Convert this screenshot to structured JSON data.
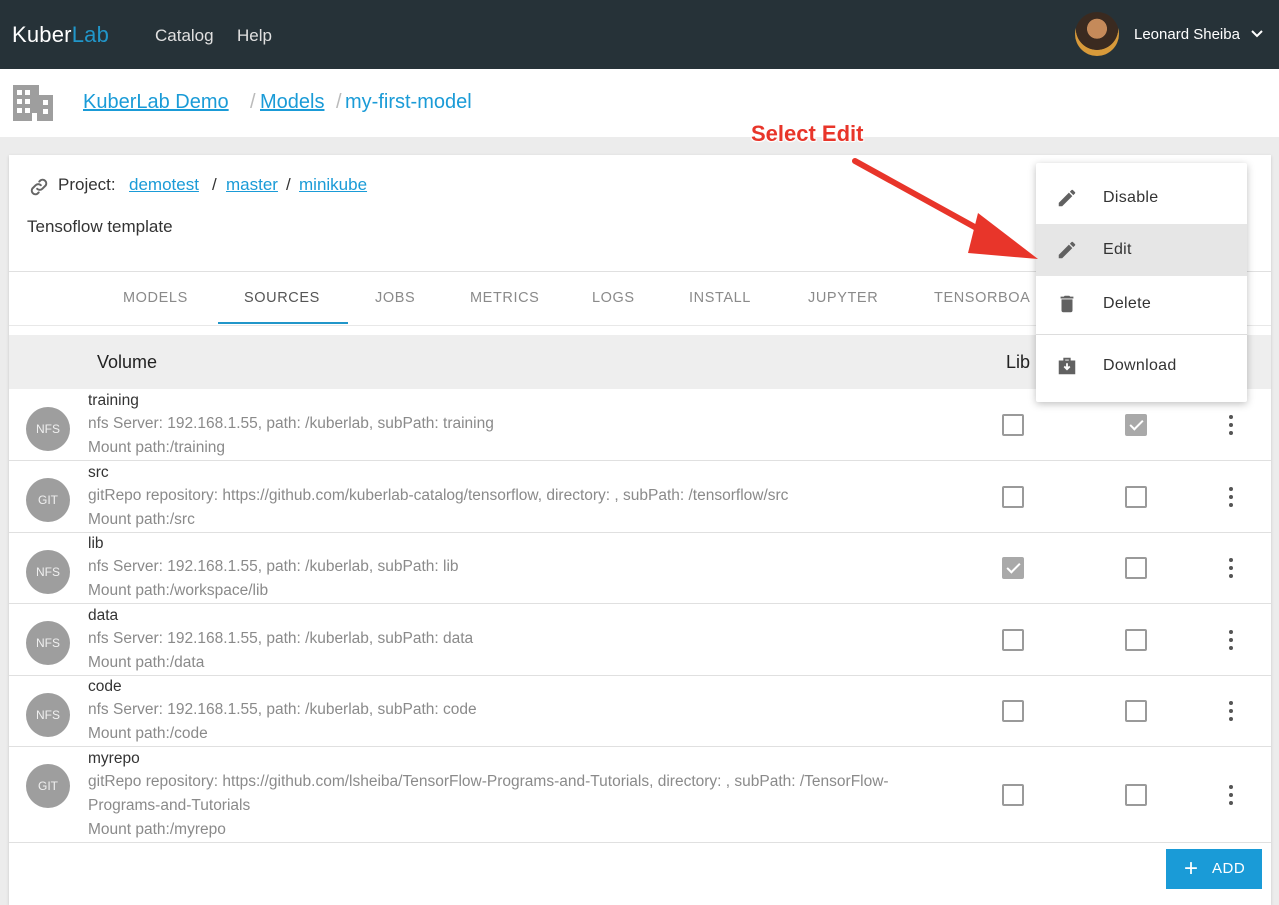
{
  "header": {
    "logo_main": "Kuber",
    "logo_accent": "Lab",
    "nav": [
      "Catalog",
      "Help"
    ],
    "user_name": "Leonard Sheiba"
  },
  "breadcrumb": {
    "org": "KuberLab Demo",
    "sep1": "/",
    "section": "Models",
    "sep2": "/",
    "item": "my-first-model"
  },
  "project": {
    "label": "Project:",
    "repo": "demotest",
    "branch": "master",
    "cluster": "minikube",
    "slash": "/",
    "template": "Tensoflow template"
  },
  "tabs": [
    "MODELS",
    "SOURCES",
    "JOBS",
    "METRICS",
    "LOGS",
    "INSTALL",
    "JUPYTER",
    "TENSORBOA"
  ],
  "active_tab": "SOURCES",
  "table": {
    "col_volume": "Volume",
    "col_lib": "Lib",
    "rows": [
      {
        "type": "NFS",
        "name": "training",
        "desc": "nfs Server: 192.168.1.55, path: /kuberlab, subPath: training",
        "mount": "Mount path:/training",
        "lib": false,
        "second": true
      },
      {
        "type": "GIT",
        "name": "src",
        "desc": "gitRepo repository: https://github.com/kuberlab-catalog/tensorflow, directory: , subPath: /tensorflow/src",
        "mount": "Mount path:/src",
        "lib": false,
        "second": false
      },
      {
        "type": "NFS",
        "name": "lib",
        "desc": "nfs Server: 192.168.1.55, path: /kuberlab, subPath: lib",
        "mount": "Mount path:/workspace/lib",
        "lib": true,
        "second": false
      },
      {
        "type": "NFS",
        "name": "data",
        "desc": "nfs Server: 192.168.1.55, path: /kuberlab, subPath: data",
        "mount": "Mount path:/data",
        "lib": false,
        "second": false
      },
      {
        "type": "NFS",
        "name": "code",
        "desc": "nfs Server: 192.168.1.55, path: /kuberlab, subPath: code",
        "mount": "Mount path:/code",
        "lib": false,
        "second": false
      },
      {
        "type": "GIT",
        "name": "myrepo",
        "desc": "gitRepo repository: https://github.com/lsheiba/TensorFlow-Programs-and-Tutorials, directory: , subPath: /TensorFlow-Programs-and-Tutorials",
        "mount": "Mount path:/myrepo",
        "lib": false,
        "second": false
      }
    ]
  },
  "add_button": {
    "plus": "+",
    "label": "ADD"
  },
  "menu": {
    "items": [
      "Disable",
      "Edit",
      "Delete",
      "Download"
    ],
    "highlighted": "Edit"
  },
  "annotation": "Select Edit",
  "colors": {
    "accent": "#1a9bd7",
    "topbar": "#263238",
    "annotation": "#e8352a"
  },
  "icons": [
    "building-icon",
    "link-icon",
    "pencil-icon",
    "trash-icon",
    "download-icon",
    "chevron-down-icon",
    "kebab-icon",
    "plus-icon"
  ]
}
